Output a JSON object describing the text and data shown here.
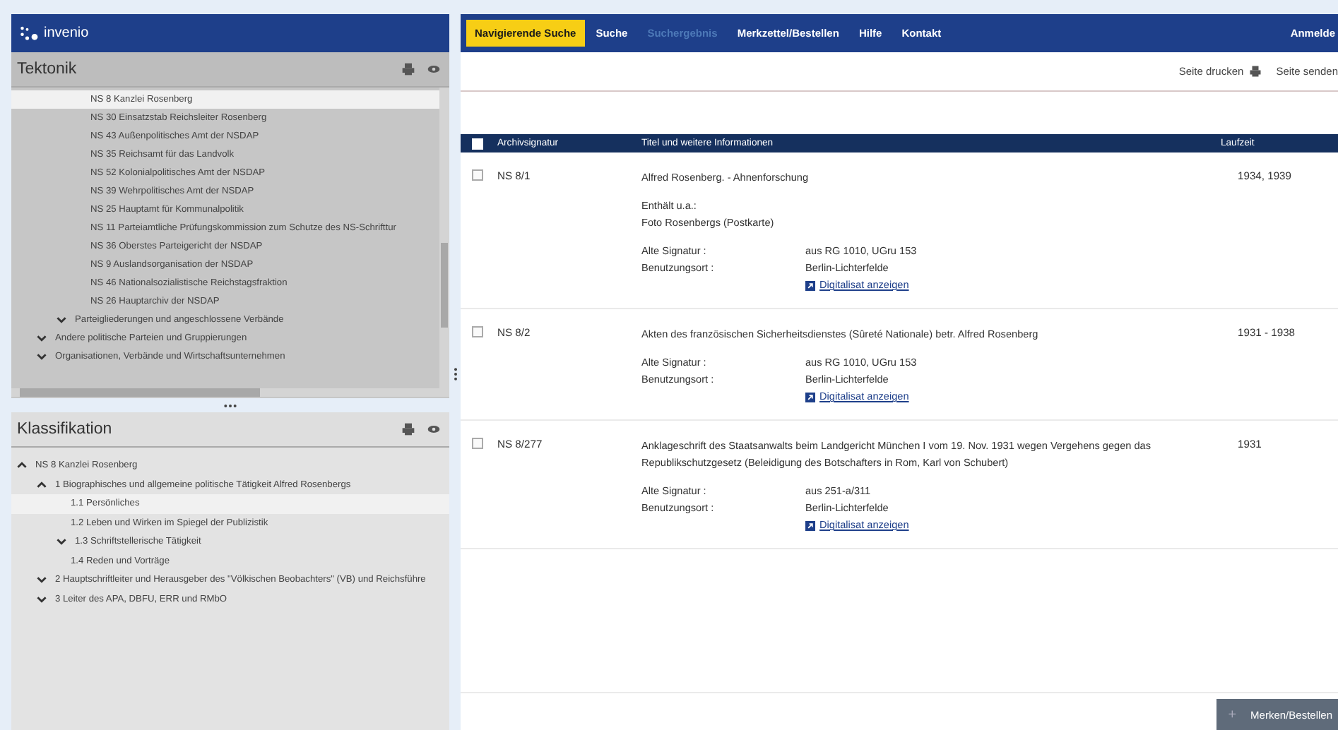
{
  "logo": {
    "text": "invenio"
  },
  "tektonik": {
    "title": "Tektonik",
    "items": [
      {
        "children": [
          {
            "children": [
              {
                "label": "NS 8 Kanzlei Rosenberg",
                "selected": true
              },
              {
                "label": "NS 30 Einsatzstab Reichsleiter Rosenberg",
                "selected": false
              },
              {
                "label": "NS 43 Außenpolitisches Amt der NSDAP",
                "selected": false
              },
              {
                "label": "NS 35 Reichsamt für das Landvolk",
                "selected": false
              },
              {
                "label": "NS 52 Kolonialpolitisches Amt der NSDAP",
                "selected": false
              },
              {
                "label": "NS 39 Wehrpolitisches Amt der NSDAP",
                "selected": false
              },
              {
                "label": "NS 25 Hauptamt für Kommunalpolitik",
                "selected": false
              },
              {
                "label": "NS 11 Parteiamtliche Prüfungskommission zum Schutze des NS-Schrifttur",
                "selected": false
              },
              {
                "label": "NS 36 Oberstes Parteigericht der NSDAP",
                "selected": false
              },
              {
                "label": "NS 9 Auslandsorganisation der NSDAP",
                "selected": false
              },
              {
                "label": "NS 46 Nationalsozialistische Reichstagsfraktion",
                "selected": false
              },
              {
                "label": "NS 26 Hauptarchiv der NSDAP",
                "selected": false
              }
            ]
          },
          {
            "label": "Parteigliederungen und angeschlossene Verbände",
            "selected": false,
            "expanded": false
          }
        ]
      },
      {
        "label": "Andere politische Parteien und Gruppierungen",
        "selected": false,
        "expanded": false
      },
      {
        "label": "Organisationen, Verbände und Wirtschaftsunternehmen",
        "selected": false,
        "expanded": false
      }
    ]
  },
  "klassifikation": {
    "title": "Klassifikation",
    "items": [
      {
        "label": "NS 8 Kanzlei Rosenberg",
        "selected": false,
        "expanded": true,
        "children": [
          {
            "label": "1 Biographisches und allgemeine politische Tätigkeit Alfred Rosenbergs",
            "selected": false,
            "expanded": true,
            "children": [
              {
                "label": "1.1 Persönliches",
                "selected": true
              },
              {
                "label": "1.2 Leben und Wirken im Spiegel der Publizistik",
                "selected": false
              },
              {
                "label": "1.3 Schriftstellerische Tätigkeit",
                "selected": false,
                "expanded": false
              },
              {
                "label": "1.4 Reden und Vorträge",
                "selected": false
              }
            ]
          },
          {
            "label": "2 Hauptschriftleiter und Herausgeber des \"Völkischen Beobachters\" (VB) und Reichsführe",
            "selected": false,
            "expanded": false
          },
          {
            "label": "3 Leiter des APA, DBFU, ERR und RMbO",
            "selected": false,
            "expanded": false
          }
        ]
      }
    ]
  },
  "nav": {
    "tabs": [
      {
        "label": "Navigierende Suche",
        "selected": true,
        "disabled": false
      },
      {
        "label": "Suche",
        "selected": false,
        "disabled": false
      },
      {
        "label": "Suchergebnis",
        "selected": false,
        "disabled": true
      },
      {
        "label": "Merkzettel/Bestellen",
        "selected": false,
        "disabled": false
      },
      {
        "label": "Hilfe",
        "selected": false,
        "disabled": false
      },
      {
        "label": "Kontakt",
        "selected": false,
        "disabled": false
      }
    ],
    "login": "Anmelde"
  },
  "toolbar": {
    "print": "Seite drucken",
    "send": "Seite senden"
  },
  "table": {
    "all_checked": false,
    "columns": [
      "Archivsignatur",
      "Titel und weitere Informationen",
      "Laufzeit"
    ],
    "rows": [
      {
        "checked": false,
        "signature": "NS 8/1",
        "title": "Alfred Rosenberg. - Ahnenforschung",
        "notes": [
          "Enthält u.a.:",
          "Foto Rosenbergs (Postkarte)"
        ],
        "fields": [
          {
            "label": "Alte Signatur :",
            "value": "aus RG 1010, UGru 153"
          },
          {
            "label": "Benutzungsort :",
            "value": "Berlin-Lichterfelde"
          }
        ],
        "link": "Digitalisat anzeigen",
        "date": "1934, 1939"
      },
      {
        "checked": false,
        "signature": "NS 8/2",
        "title": "Akten des französischen Sicherheitsdienstes (Sûreté Nationale) betr. Alfred Rosenberg",
        "fields": [
          {
            "label": "Alte Signatur :",
            "value": "aus RG 1010, UGru 153"
          },
          {
            "label": "Benutzungsort :",
            "value": "Berlin-Lichterfelde"
          }
        ],
        "link": "Digitalisat anzeigen",
        "date": "1931 - 1938"
      },
      {
        "checked": false,
        "signature": "NS 8/277",
        "title": "Anklageschrift des Staatsanwalts beim Landgericht München I vom 19. Nov. 1931 wegen Vergehens gegen das Republikschutzgesetz (Beleidigung des Botschafters in Rom, Karl von Schubert)",
        "fields": [
          {
            "label": "Alte Signatur :",
            "value": "aus 251-a/311"
          },
          {
            "label": "Benutzungsort :",
            "value": "Berlin-Lichterfelde"
          }
        ],
        "link": "Digitalisat anzeigen",
        "date": "1931"
      }
    ]
  },
  "order_button": {
    "icon": "+",
    "label": "Merken/Bestellen"
  }
}
